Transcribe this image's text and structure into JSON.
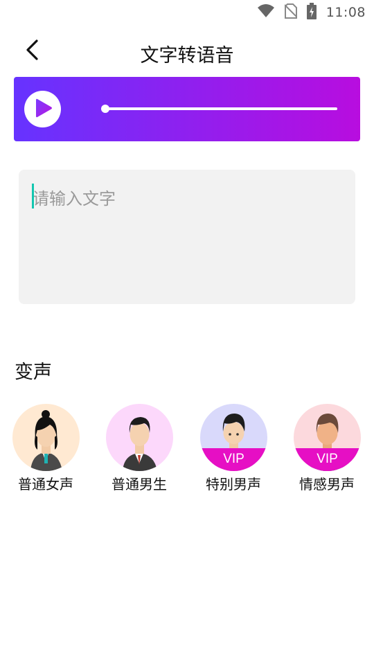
{
  "status_bar": {
    "time": "11:08",
    "icons": [
      "wifi-icon",
      "no-sim-icon",
      "battery-charging-icon"
    ]
  },
  "header": {
    "back_icon": "back-arrow-icon",
    "title": "文字转语音"
  },
  "player": {
    "play_icon": "play-icon",
    "progress": 0,
    "colors": {
      "start": "#6633ff",
      "end": "#b80ddf"
    }
  },
  "input": {
    "placeholder": "请输入文字",
    "value": ""
  },
  "voice_section": {
    "title": "变声",
    "voices": [
      {
        "label": "普通女声",
        "vip": false,
        "bg": "#ffe9d2"
      },
      {
        "label": "普通男生",
        "vip": false,
        "bg": "#fcd8fb"
      },
      {
        "label": "特别男声",
        "vip": true,
        "vip_label": "VIP",
        "bg": "#d9d9fb"
      },
      {
        "label": "情感男声",
        "vip": true,
        "vip_label": "VIP",
        "bg": "#fcd9dd"
      }
    ]
  }
}
